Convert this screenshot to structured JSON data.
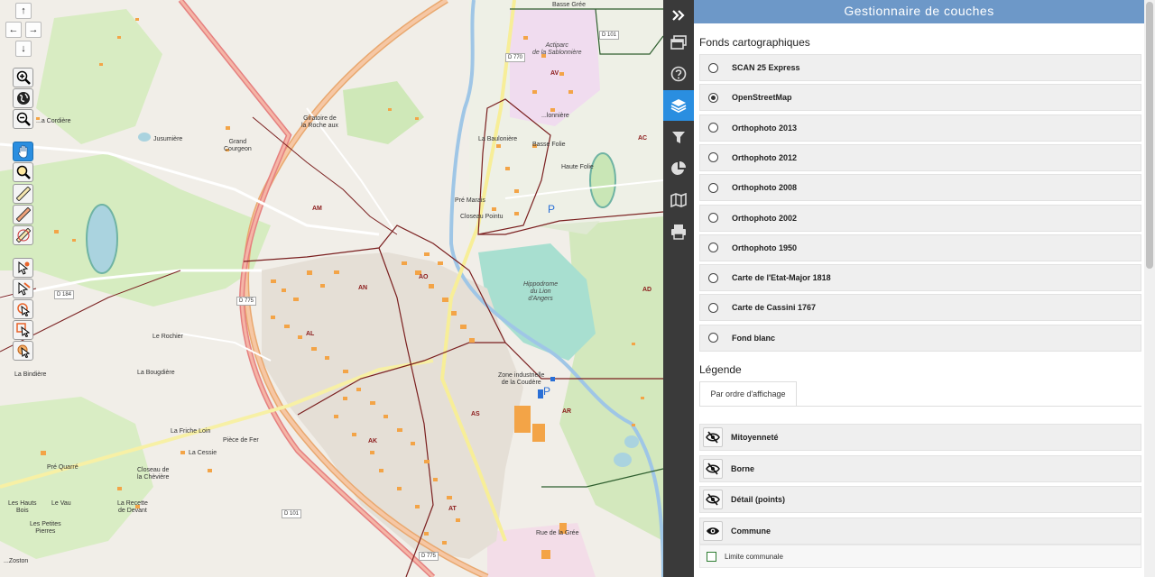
{
  "panel": {
    "title": "Gestionnaire de couches",
    "basemaps_title": "Fonds cartographiques",
    "basemaps": [
      {
        "label": "SCAN 25 Express",
        "selected": false
      },
      {
        "label": "OpenStreetMap",
        "selected": true
      },
      {
        "label": "Orthophoto 2013",
        "selected": false
      },
      {
        "label": "Orthophoto 2012",
        "selected": false
      },
      {
        "label": "Orthophoto 2008",
        "selected": false
      },
      {
        "label": "Orthophoto 2002",
        "selected": false
      },
      {
        "label": "Orthophoto 1950",
        "selected": false
      },
      {
        "label": "Carte de l'Etat-Major 1818",
        "selected": false
      },
      {
        "label": "Carte de Cassini 1767",
        "selected": false
      },
      {
        "label": "Fond blanc",
        "selected": false
      }
    ],
    "legend_title": "Légende",
    "legend_tab": "Par ordre d'affichage",
    "layers": [
      {
        "label": "Mitoyenneté",
        "visible": false
      },
      {
        "label": "Borne",
        "visible": false
      },
      {
        "label": "Détail (points)",
        "visible": false
      },
      {
        "label": "Commune",
        "visible": true
      }
    ],
    "sublayer": {
      "label": "Limite communale"
    }
  },
  "sidebar": {
    "items": [
      "collapse-icon",
      "windows-icon",
      "help-icon",
      "layers-icon",
      "filter-icon",
      "pie-chart-icon",
      "map-icon",
      "print-icon"
    ],
    "active": "layers-icon",
    "accent": "#2a8ee0"
  },
  "map": {
    "labels": {
      "basse_gree": "Basse Grée",
      "actiparc": "Actiparc\nde la Sablonnière",
      "av": "AV",
      "d101a": "D 101",
      "d770": "D 770",
      "lanniere": "...lonnière",
      "ac": "AC",
      "giratoire": "Giratoire de\nla Roche aux",
      "la_cordiere": "...a Cordière",
      "jusumiere": "Jusumière",
      "grand_courgeon": "Grand\nCourgeon",
      "la_bauloniere": "La Baulonière",
      "basse_folie": "Basse Folie",
      "haute_folie": "Haute Folie",
      "am": "AM",
      "pre_marais": "Pré Marais",
      "closeau_pointu": "Closeau Pointu",
      "hippodrome": "Hippodrome\ndu Lion\nd'Angers",
      "ao": "AO",
      "an": "AN",
      "d184": "D 184",
      "d775a": "D 775",
      "al": "AL",
      "ad": "AD",
      "le_rochier": "Le Rochier",
      "la_bougdiere": "La Bougdière",
      "la_bindiere": "La Bindière",
      "zone_ind": "Zone industrielle\nde la Coudère",
      "as": "AS",
      "ar": "AR",
      "la_friche_loin": "La Friche Loin",
      "piece_de_fer": "Pièce de Fer",
      "la_cessie": "La Cessie",
      "ak": "AK",
      "pre_quarre": "Pré Quarré",
      "closeau_cheviere": "Closeau de\nla Chèvière",
      "les_hauts_bois": "Les Hauts\nBois",
      "le_vau": "Le Vau",
      "la_recette": "La Recette\nde Devant",
      "les_petites_pierres": "Les Petites\nPierres",
      "at": "AT",
      "d101b": "D 101",
      "d775b": "D 775",
      "rue_gree": "Rue de la Grée",
      "zoston": "...Zoston",
      "p1": "P",
      "p2": "P"
    }
  }
}
